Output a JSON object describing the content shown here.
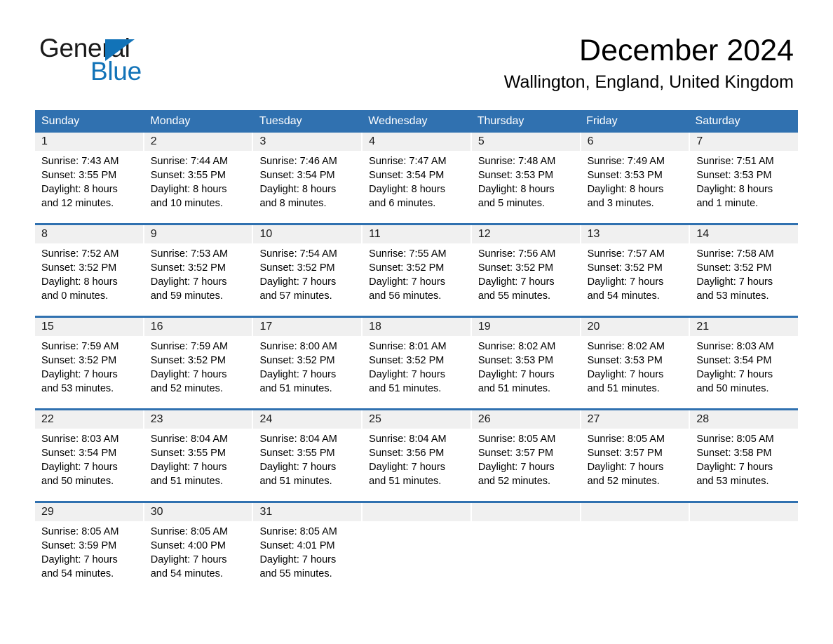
{
  "brand": {
    "name_part1": "General",
    "name_part2": "Blue",
    "accent_color": "#1273b8",
    "triangle_icon": "triangle-icon"
  },
  "header": {
    "month_title": "December 2024",
    "location": "Wallington, England, United Kingdom"
  },
  "calendar": {
    "header_color": "#3071b0",
    "weekdays": [
      "Sunday",
      "Monday",
      "Tuesday",
      "Wednesday",
      "Thursday",
      "Friday",
      "Saturday"
    ],
    "weeks": [
      [
        {
          "day": "1",
          "sunrise": "Sunrise: 7:43 AM",
          "sunset": "Sunset: 3:55 PM",
          "daylight_line1": "Daylight: 8 hours",
          "daylight_line2": "and 12 minutes."
        },
        {
          "day": "2",
          "sunrise": "Sunrise: 7:44 AM",
          "sunset": "Sunset: 3:55 PM",
          "daylight_line1": "Daylight: 8 hours",
          "daylight_line2": "and 10 minutes."
        },
        {
          "day": "3",
          "sunrise": "Sunrise: 7:46 AM",
          "sunset": "Sunset: 3:54 PM",
          "daylight_line1": "Daylight: 8 hours",
          "daylight_line2": "and 8 minutes."
        },
        {
          "day": "4",
          "sunrise": "Sunrise: 7:47 AM",
          "sunset": "Sunset: 3:54 PM",
          "daylight_line1": "Daylight: 8 hours",
          "daylight_line2": "and 6 minutes."
        },
        {
          "day": "5",
          "sunrise": "Sunrise: 7:48 AM",
          "sunset": "Sunset: 3:53 PM",
          "daylight_line1": "Daylight: 8 hours",
          "daylight_line2": "and 5 minutes."
        },
        {
          "day": "6",
          "sunrise": "Sunrise: 7:49 AM",
          "sunset": "Sunset: 3:53 PM",
          "daylight_line1": "Daylight: 8 hours",
          "daylight_line2": "and 3 minutes."
        },
        {
          "day": "7",
          "sunrise": "Sunrise: 7:51 AM",
          "sunset": "Sunset: 3:53 PM",
          "daylight_line1": "Daylight: 8 hours",
          "daylight_line2": "and 1 minute."
        }
      ],
      [
        {
          "day": "8",
          "sunrise": "Sunrise: 7:52 AM",
          "sunset": "Sunset: 3:52 PM",
          "daylight_line1": "Daylight: 8 hours",
          "daylight_line2": "and 0 minutes."
        },
        {
          "day": "9",
          "sunrise": "Sunrise: 7:53 AM",
          "sunset": "Sunset: 3:52 PM",
          "daylight_line1": "Daylight: 7 hours",
          "daylight_line2": "and 59 minutes."
        },
        {
          "day": "10",
          "sunrise": "Sunrise: 7:54 AM",
          "sunset": "Sunset: 3:52 PM",
          "daylight_line1": "Daylight: 7 hours",
          "daylight_line2": "and 57 minutes."
        },
        {
          "day": "11",
          "sunrise": "Sunrise: 7:55 AM",
          "sunset": "Sunset: 3:52 PM",
          "daylight_line1": "Daylight: 7 hours",
          "daylight_line2": "and 56 minutes."
        },
        {
          "day": "12",
          "sunrise": "Sunrise: 7:56 AM",
          "sunset": "Sunset: 3:52 PM",
          "daylight_line1": "Daylight: 7 hours",
          "daylight_line2": "and 55 minutes."
        },
        {
          "day": "13",
          "sunrise": "Sunrise: 7:57 AM",
          "sunset": "Sunset: 3:52 PM",
          "daylight_line1": "Daylight: 7 hours",
          "daylight_line2": "and 54 minutes."
        },
        {
          "day": "14",
          "sunrise": "Sunrise: 7:58 AM",
          "sunset": "Sunset: 3:52 PM",
          "daylight_line1": "Daylight: 7 hours",
          "daylight_line2": "and 53 minutes."
        }
      ],
      [
        {
          "day": "15",
          "sunrise": "Sunrise: 7:59 AM",
          "sunset": "Sunset: 3:52 PM",
          "daylight_line1": "Daylight: 7 hours",
          "daylight_line2": "and 53 minutes."
        },
        {
          "day": "16",
          "sunrise": "Sunrise: 7:59 AM",
          "sunset": "Sunset: 3:52 PM",
          "daylight_line1": "Daylight: 7 hours",
          "daylight_line2": "and 52 minutes."
        },
        {
          "day": "17",
          "sunrise": "Sunrise: 8:00 AM",
          "sunset": "Sunset: 3:52 PM",
          "daylight_line1": "Daylight: 7 hours",
          "daylight_line2": "and 51 minutes."
        },
        {
          "day": "18",
          "sunrise": "Sunrise: 8:01 AM",
          "sunset": "Sunset: 3:52 PM",
          "daylight_line1": "Daylight: 7 hours",
          "daylight_line2": "and 51 minutes."
        },
        {
          "day": "19",
          "sunrise": "Sunrise: 8:02 AM",
          "sunset": "Sunset: 3:53 PM",
          "daylight_line1": "Daylight: 7 hours",
          "daylight_line2": "and 51 minutes."
        },
        {
          "day": "20",
          "sunrise": "Sunrise: 8:02 AM",
          "sunset": "Sunset: 3:53 PM",
          "daylight_line1": "Daylight: 7 hours",
          "daylight_line2": "and 51 minutes."
        },
        {
          "day": "21",
          "sunrise": "Sunrise: 8:03 AM",
          "sunset": "Sunset: 3:54 PM",
          "daylight_line1": "Daylight: 7 hours",
          "daylight_line2": "and 50 minutes."
        }
      ],
      [
        {
          "day": "22",
          "sunrise": "Sunrise: 8:03 AM",
          "sunset": "Sunset: 3:54 PM",
          "daylight_line1": "Daylight: 7 hours",
          "daylight_line2": "and 50 minutes."
        },
        {
          "day": "23",
          "sunrise": "Sunrise: 8:04 AM",
          "sunset": "Sunset: 3:55 PM",
          "daylight_line1": "Daylight: 7 hours",
          "daylight_line2": "and 51 minutes."
        },
        {
          "day": "24",
          "sunrise": "Sunrise: 8:04 AM",
          "sunset": "Sunset: 3:55 PM",
          "daylight_line1": "Daylight: 7 hours",
          "daylight_line2": "and 51 minutes."
        },
        {
          "day": "25",
          "sunrise": "Sunrise: 8:04 AM",
          "sunset": "Sunset: 3:56 PM",
          "daylight_line1": "Daylight: 7 hours",
          "daylight_line2": "and 51 minutes."
        },
        {
          "day": "26",
          "sunrise": "Sunrise: 8:05 AM",
          "sunset": "Sunset: 3:57 PM",
          "daylight_line1": "Daylight: 7 hours",
          "daylight_line2": "and 52 minutes."
        },
        {
          "day": "27",
          "sunrise": "Sunrise: 8:05 AM",
          "sunset": "Sunset: 3:57 PM",
          "daylight_line1": "Daylight: 7 hours",
          "daylight_line2": "and 52 minutes."
        },
        {
          "day": "28",
          "sunrise": "Sunrise: 8:05 AM",
          "sunset": "Sunset: 3:58 PM",
          "daylight_line1": "Daylight: 7 hours",
          "daylight_line2": "and 53 minutes."
        }
      ],
      [
        {
          "day": "29",
          "sunrise": "Sunrise: 8:05 AM",
          "sunset": "Sunset: 3:59 PM",
          "daylight_line1": "Daylight: 7 hours",
          "daylight_line2": "and 54 minutes."
        },
        {
          "day": "30",
          "sunrise": "Sunrise: 8:05 AM",
          "sunset": "Sunset: 4:00 PM",
          "daylight_line1": "Daylight: 7 hours",
          "daylight_line2": "and 54 minutes."
        },
        {
          "day": "31",
          "sunrise": "Sunrise: 8:05 AM",
          "sunset": "Sunset: 4:01 PM",
          "daylight_line1": "Daylight: 7 hours",
          "daylight_line2": "and 55 minutes."
        },
        {
          "day": "",
          "sunrise": "",
          "sunset": "",
          "daylight_line1": "",
          "daylight_line2": ""
        },
        {
          "day": "",
          "sunrise": "",
          "sunset": "",
          "daylight_line1": "",
          "daylight_line2": ""
        },
        {
          "day": "",
          "sunrise": "",
          "sunset": "",
          "daylight_line1": "",
          "daylight_line2": ""
        },
        {
          "day": "",
          "sunrise": "",
          "sunset": "",
          "daylight_line1": "",
          "daylight_line2": ""
        }
      ]
    ]
  }
}
